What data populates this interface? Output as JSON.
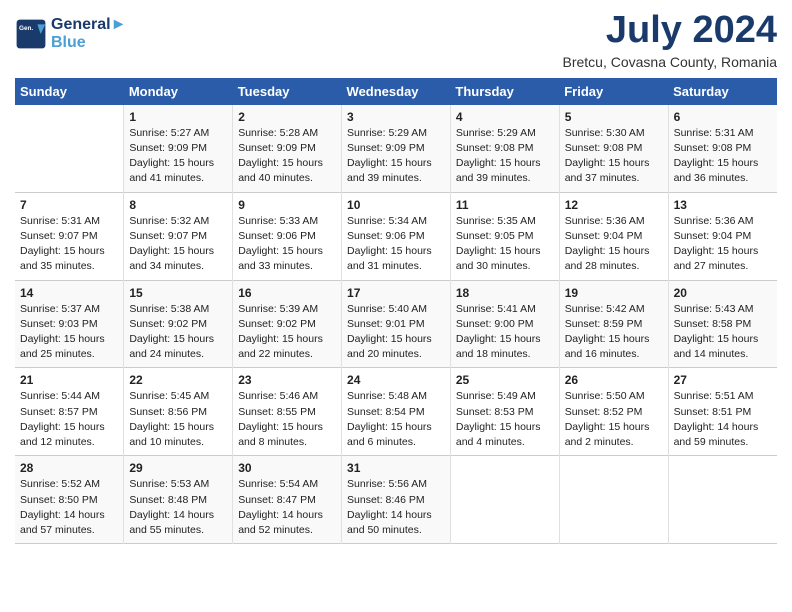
{
  "header": {
    "logo_line1": "General",
    "logo_line2": "Blue",
    "month_title": "July 2024",
    "subtitle": "Bretcu, Covasna County, Romania"
  },
  "days_of_week": [
    "Sunday",
    "Monday",
    "Tuesday",
    "Wednesday",
    "Thursday",
    "Friday",
    "Saturday"
  ],
  "weeks": [
    [
      {
        "day": "",
        "info": ""
      },
      {
        "day": "1",
        "info": "Sunrise: 5:27 AM\nSunset: 9:09 PM\nDaylight: 15 hours\nand 41 minutes."
      },
      {
        "day": "2",
        "info": "Sunrise: 5:28 AM\nSunset: 9:09 PM\nDaylight: 15 hours\nand 40 minutes."
      },
      {
        "day": "3",
        "info": "Sunrise: 5:29 AM\nSunset: 9:09 PM\nDaylight: 15 hours\nand 39 minutes."
      },
      {
        "day": "4",
        "info": "Sunrise: 5:29 AM\nSunset: 9:08 PM\nDaylight: 15 hours\nand 39 minutes."
      },
      {
        "day": "5",
        "info": "Sunrise: 5:30 AM\nSunset: 9:08 PM\nDaylight: 15 hours\nand 37 minutes."
      },
      {
        "day": "6",
        "info": "Sunrise: 5:31 AM\nSunset: 9:08 PM\nDaylight: 15 hours\nand 36 minutes."
      }
    ],
    [
      {
        "day": "7",
        "info": "Sunrise: 5:31 AM\nSunset: 9:07 PM\nDaylight: 15 hours\nand 35 minutes."
      },
      {
        "day": "8",
        "info": "Sunrise: 5:32 AM\nSunset: 9:07 PM\nDaylight: 15 hours\nand 34 minutes."
      },
      {
        "day": "9",
        "info": "Sunrise: 5:33 AM\nSunset: 9:06 PM\nDaylight: 15 hours\nand 33 minutes."
      },
      {
        "day": "10",
        "info": "Sunrise: 5:34 AM\nSunset: 9:06 PM\nDaylight: 15 hours\nand 31 minutes."
      },
      {
        "day": "11",
        "info": "Sunrise: 5:35 AM\nSunset: 9:05 PM\nDaylight: 15 hours\nand 30 minutes."
      },
      {
        "day": "12",
        "info": "Sunrise: 5:36 AM\nSunset: 9:04 PM\nDaylight: 15 hours\nand 28 minutes."
      },
      {
        "day": "13",
        "info": "Sunrise: 5:36 AM\nSunset: 9:04 PM\nDaylight: 15 hours\nand 27 minutes."
      }
    ],
    [
      {
        "day": "14",
        "info": "Sunrise: 5:37 AM\nSunset: 9:03 PM\nDaylight: 15 hours\nand 25 minutes."
      },
      {
        "day": "15",
        "info": "Sunrise: 5:38 AM\nSunset: 9:02 PM\nDaylight: 15 hours\nand 24 minutes."
      },
      {
        "day": "16",
        "info": "Sunrise: 5:39 AM\nSunset: 9:02 PM\nDaylight: 15 hours\nand 22 minutes."
      },
      {
        "day": "17",
        "info": "Sunrise: 5:40 AM\nSunset: 9:01 PM\nDaylight: 15 hours\nand 20 minutes."
      },
      {
        "day": "18",
        "info": "Sunrise: 5:41 AM\nSunset: 9:00 PM\nDaylight: 15 hours\nand 18 minutes."
      },
      {
        "day": "19",
        "info": "Sunrise: 5:42 AM\nSunset: 8:59 PM\nDaylight: 15 hours\nand 16 minutes."
      },
      {
        "day": "20",
        "info": "Sunrise: 5:43 AM\nSunset: 8:58 PM\nDaylight: 15 hours\nand 14 minutes."
      }
    ],
    [
      {
        "day": "21",
        "info": "Sunrise: 5:44 AM\nSunset: 8:57 PM\nDaylight: 15 hours\nand 12 minutes."
      },
      {
        "day": "22",
        "info": "Sunrise: 5:45 AM\nSunset: 8:56 PM\nDaylight: 15 hours\nand 10 minutes."
      },
      {
        "day": "23",
        "info": "Sunrise: 5:46 AM\nSunset: 8:55 PM\nDaylight: 15 hours\nand 8 minutes."
      },
      {
        "day": "24",
        "info": "Sunrise: 5:48 AM\nSunset: 8:54 PM\nDaylight: 15 hours\nand 6 minutes."
      },
      {
        "day": "25",
        "info": "Sunrise: 5:49 AM\nSunset: 8:53 PM\nDaylight: 15 hours\nand 4 minutes."
      },
      {
        "day": "26",
        "info": "Sunrise: 5:50 AM\nSunset: 8:52 PM\nDaylight: 15 hours\nand 2 minutes."
      },
      {
        "day": "27",
        "info": "Sunrise: 5:51 AM\nSunset: 8:51 PM\nDaylight: 14 hours\nand 59 minutes."
      }
    ],
    [
      {
        "day": "28",
        "info": "Sunrise: 5:52 AM\nSunset: 8:50 PM\nDaylight: 14 hours\nand 57 minutes."
      },
      {
        "day": "29",
        "info": "Sunrise: 5:53 AM\nSunset: 8:48 PM\nDaylight: 14 hours\nand 55 minutes."
      },
      {
        "day": "30",
        "info": "Sunrise: 5:54 AM\nSunset: 8:47 PM\nDaylight: 14 hours\nand 52 minutes."
      },
      {
        "day": "31",
        "info": "Sunrise: 5:56 AM\nSunset: 8:46 PM\nDaylight: 14 hours\nand 50 minutes."
      },
      {
        "day": "",
        "info": ""
      },
      {
        "day": "",
        "info": ""
      },
      {
        "day": "",
        "info": ""
      }
    ]
  ]
}
